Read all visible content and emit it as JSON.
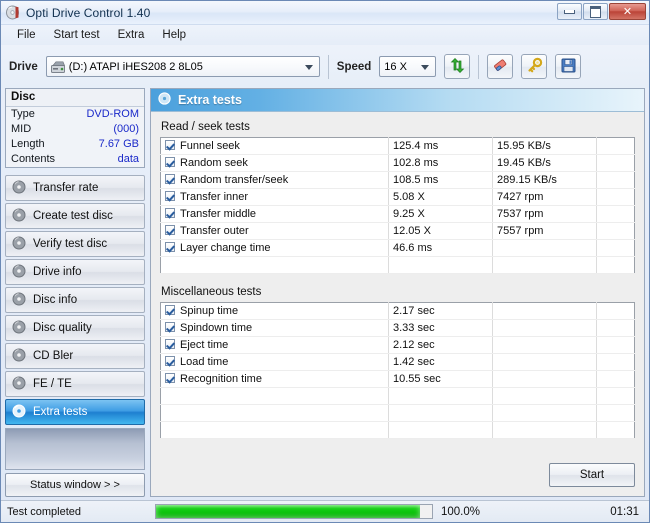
{
  "window": {
    "title": "Opti Drive Control 1.40",
    "app_icon": "disc-icon",
    "controls": {
      "minimize": "minimize-icon",
      "maximize": "maximize-icon",
      "close": "✕"
    }
  },
  "menu": {
    "items": [
      "File",
      "Start test",
      "Extra",
      "Help"
    ]
  },
  "toolbar": {
    "drive_label": "Drive",
    "drive_value": "(D:)   ATAPI iHES208   2 8L05",
    "speed_label": "Speed",
    "speed_value": "16 X",
    "buttons": [
      {
        "name": "refresh-button",
        "icon": "refresh-arrows-icon"
      },
      {
        "name": "erase-button",
        "icon": "eraser-icon"
      },
      {
        "name": "key-button",
        "icon": "key-icon"
      },
      {
        "name": "save-button",
        "icon": "floppy-disk-icon"
      }
    ]
  },
  "sidebar": {
    "disc": {
      "header": "Disc",
      "rows": [
        {
          "key": "Type",
          "value": "DVD-ROM"
        },
        {
          "key": "MID",
          "value": "(000)"
        },
        {
          "key": "Length",
          "value": "7.67 GB"
        },
        {
          "key": "Contents",
          "value": "data"
        }
      ]
    },
    "items": [
      {
        "label": "Transfer rate",
        "active": false
      },
      {
        "label": "Create test disc",
        "active": false
      },
      {
        "label": "Verify test disc",
        "active": false
      },
      {
        "label": "Drive info",
        "active": false
      },
      {
        "label": "Disc info",
        "active": false
      },
      {
        "label": "Disc quality",
        "active": false
      },
      {
        "label": "CD Bler",
        "active": false
      },
      {
        "label": "FE / TE",
        "active": false
      },
      {
        "label": "Extra tests",
        "active": true
      }
    ],
    "status_window_button": "Status window > >"
  },
  "main": {
    "panel_title": "Extra tests",
    "panel_icon": "disc-icon",
    "read_seek": {
      "label": "Read / seek tests",
      "rows": [
        {
          "checked": true,
          "name": "Funnel seek",
          "v1": "125.4 ms",
          "v2": "15.95 KB/s"
        },
        {
          "checked": true,
          "name": "Random seek",
          "v1": "102.8 ms",
          "v2": "19.45 KB/s"
        },
        {
          "checked": true,
          "name": "Random transfer/seek",
          "v1": "108.5 ms",
          "v2": "289.15 KB/s"
        },
        {
          "checked": true,
          "name": "Transfer inner",
          "v1": "5.08 X",
          "v2": "7427 rpm"
        },
        {
          "checked": true,
          "name": "Transfer middle",
          "v1": "9.25 X",
          "v2": "7537 rpm"
        },
        {
          "checked": true,
          "name": "Transfer outer",
          "v1": "12.05 X",
          "v2": "7557 rpm"
        },
        {
          "checked": true,
          "name": "Layer change time",
          "v1": "46.6 ms",
          "v2": ""
        },
        {
          "checked": false,
          "name": "",
          "v1": "",
          "v2": ""
        }
      ]
    },
    "misc": {
      "label": "Miscellaneous tests",
      "rows": [
        {
          "checked": true,
          "name": "Spinup time",
          "v1": "2.17 sec",
          "v2": ""
        },
        {
          "checked": true,
          "name": "Spindown time",
          "v1": "3.33 sec",
          "v2": ""
        },
        {
          "checked": true,
          "name": "Eject time",
          "v1": "2.12 sec",
          "v2": ""
        },
        {
          "checked": true,
          "name": "Load time",
          "v1": "1.42 sec",
          "v2": ""
        },
        {
          "checked": true,
          "name": "Recognition time",
          "v1": "10.55 sec",
          "v2": ""
        },
        {
          "checked": false,
          "name": "",
          "v1": "",
          "v2": ""
        },
        {
          "checked": false,
          "name": "",
          "v1": "",
          "v2": ""
        },
        {
          "checked": false,
          "name": "",
          "v1": "",
          "v2": ""
        }
      ]
    },
    "start_button": "Start"
  },
  "statusbar": {
    "message": "Test completed",
    "percent_label": "100.0%",
    "percent_value": 100,
    "elapsed": "01:31"
  },
  "colors": {
    "accent": "#3f9de4",
    "progress": "#0cc20c",
    "value_text": "#1a29c9",
    "close_button": "#bb4438"
  }
}
